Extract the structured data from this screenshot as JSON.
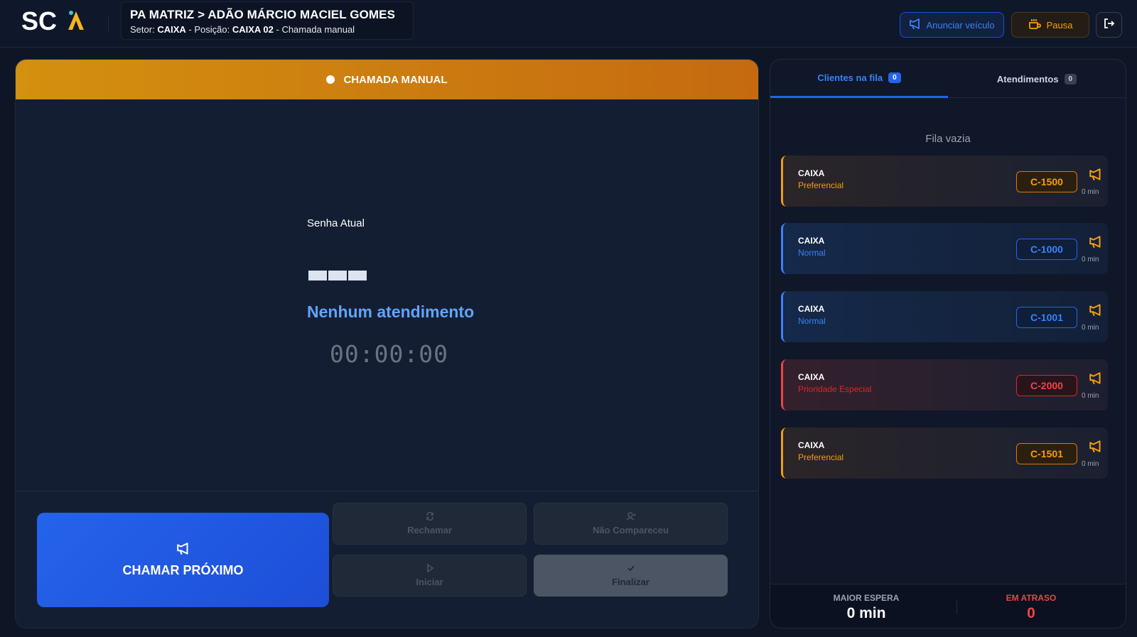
{
  "header": {
    "logo_text": "SCA",
    "title": "PA MATRIZ > ADÃO MÁRCIO MACIEL GOMES",
    "sub_setor_label": "Setor:",
    "sub_setor": "CAIXA",
    "sub_posicao_label": "- Posição:",
    "sub_posicao": "CAIXA 02",
    "sub_mode": "- Chamada manual",
    "announce_label": "Anunciar veículo",
    "pause_label": "Pausa",
    "accent_color": "#f59e0b"
  },
  "main": {
    "banner_label": "CHAMADA MANUAL",
    "senha_label": "Senha Atual",
    "status_text": "Nenhum atendimento",
    "timer": "00:00:00",
    "call_next_label": "CHAMAR PRÓXIMO",
    "rechamar_label": "Rechamar",
    "nao_compareceu_label": "Não Compareceu",
    "iniciar_label": "Iniciar",
    "finalizar_label": "Finalizar"
  },
  "side": {
    "tabs": [
      {
        "label": "Clientes na fila",
        "count": "0"
      },
      {
        "label": "Atendimentos",
        "count": "0"
      }
    ],
    "empty_text": "Fila vazia",
    "queue": [
      {
        "sector": "CAIXA",
        "type": "Preferencial",
        "code": "C-1500",
        "wait": "0 min",
        "color": "orange"
      },
      {
        "sector": "CAIXA",
        "type": "Normal",
        "code": "C-1000",
        "wait": "0 min",
        "color": "blue"
      },
      {
        "sector": "CAIXA",
        "type": "Normal",
        "code": "C-1001",
        "wait": "0 min",
        "color": "blue"
      },
      {
        "sector": "CAIXA",
        "type": "Prioridade Especial",
        "code": "C-2000",
        "wait": "0 min",
        "color": "red"
      },
      {
        "sector": "CAIXA",
        "type": "Preferencial",
        "code": "C-1501",
        "wait": "0 min",
        "color": "orange"
      }
    ],
    "footer": {
      "max_wait_label": "MAIOR ESPERA",
      "max_wait_value": "0 min",
      "late_label": "EM ATRASO",
      "late_value": "0"
    }
  }
}
